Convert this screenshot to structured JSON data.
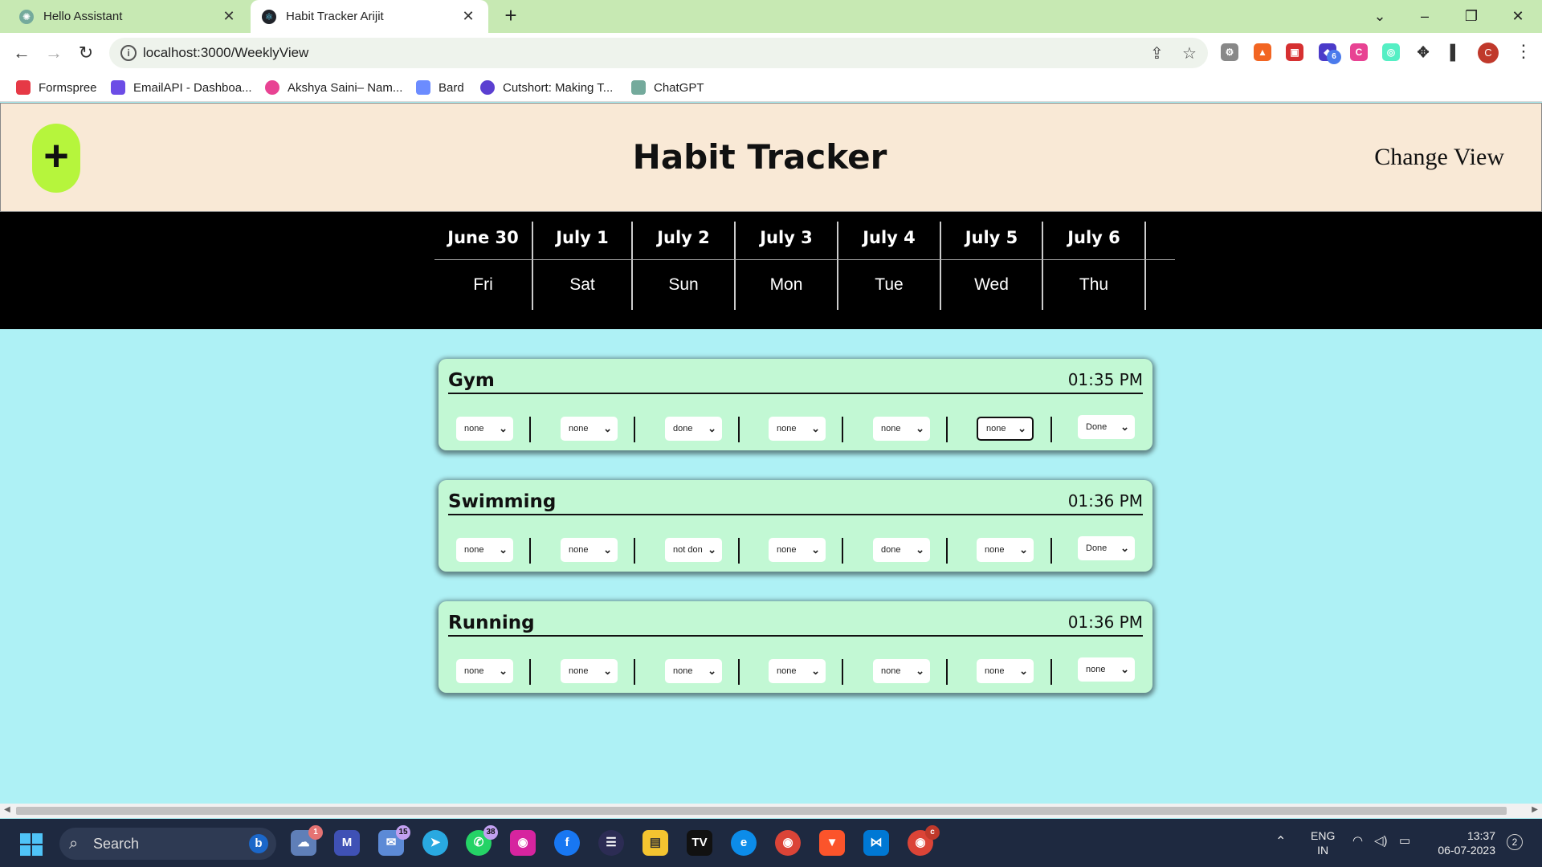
{
  "browser": {
    "tabs": [
      {
        "title": "Hello Assistant",
        "active": false
      },
      {
        "title": "Habit Tracker Arijit",
        "active": true
      }
    ],
    "url": "localhost:3000/WeeklyView",
    "profile_initial": "C",
    "extension_badge": "6",
    "bookmarks": [
      {
        "label": "Formspree",
        "color": "#e63946"
      },
      {
        "label": "EmailAPI - Dashboa...",
        "color": "#6c4de6"
      },
      {
        "label": "Akshya Saini– Nam...",
        "color": "#e84393"
      },
      {
        "label": "Bard",
        "color": "#6c8cff"
      },
      {
        "label": "Cutshort: Making T...",
        "color": "#5b3fd1"
      },
      {
        "label": "ChatGPT",
        "color": "#74aa9c"
      }
    ]
  },
  "app": {
    "add_label": "+",
    "title": "Habit Tracker",
    "change_view_label": "Change View",
    "week": [
      {
        "date": "June 30",
        "day": "Fri"
      },
      {
        "date": "July 1",
        "day": "Sat"
      },
      {
        "date": "July 2",
        "day": "Sun"
      },
      {
        "date": "July 3",
        "day": "Mon"
      },
      {
        "date": "July 4",
        "day": "Tue"
      },
      {
        "date": "July 5",
        "day": "Wed"
      },
      {
        "date": "July 6",
        "day": "Thu"
      }
    ],
    "habits": [
      {
        "name": "Gym",
        "time": "01:35 PM",
        "statuses": [
          "none",
          "none",
          "done",
          "none",
          "none",
          "none",
          "Done"
        ],
        "focused_index": 5
      },
      {
        "name": "Swimming",
        "time": "01:36 PM",
        "statuses": [
          "none",
          "none",
          "not don",
          "none",
          "done",
          "none",
          "Done"
        ]
      },
      {
        "name": "Running",
        "time": "01:36 PM",
        "statuses": [
          "none",
          "none",
          "none",
          "none",
          "none",
          "none",
          "none"
        ]
      }
    ]
  },
  "taskbar": {
    "search_placeholder": "Search",
    "badges": {
      "weather": "1",
      "mail": "15",
      "whatsapp": "38",
      "chrome": "c"
    },
    "language": "ENG",
    "region": "IN",
    "time": "13:37",
    "date": "06-07-2023",
    "notifications": "2"
  }
}
